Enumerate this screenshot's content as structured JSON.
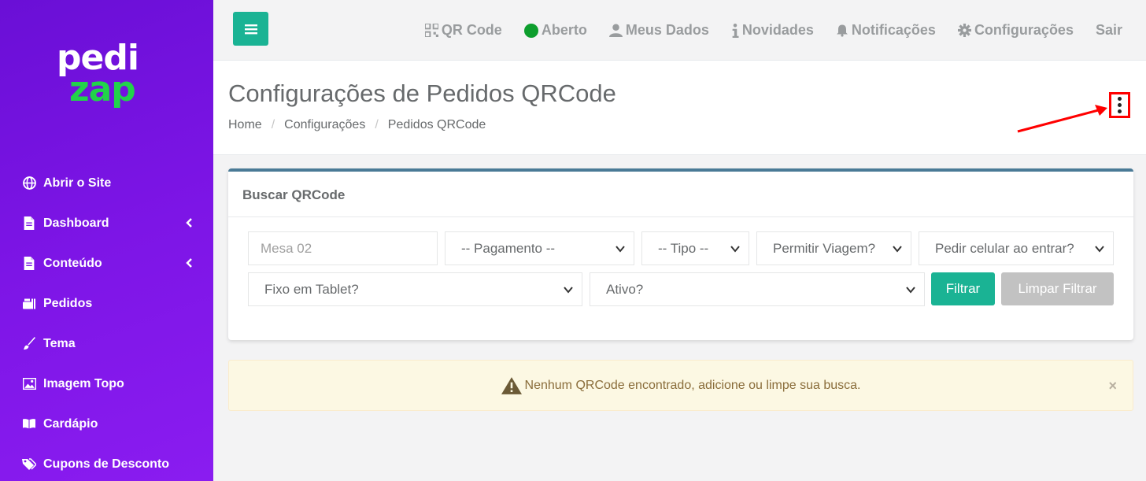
{
  "logo": {
    "line1": "pedi",
    "line2": "zap"
  },
  "sidebar": {
    "items": [
      {
        "label": "Abrir o Site",
        "icon": "globe-icon",
        "has_chevron": false
      },
      {
        "label": "Dashboard",
        "icon": "file-icon",
        "has_chevron": true
      },
      {
        "label": "Conteúdo",
        "icon": "file-icon",
        "has_chevron": true
      },
      {
        "label": "Pedidos",
        "icon": "food-icon",
        "has_chevron": false
      },
      {
        "label": "Tema",
        "icon": "brush-icon",
        "has_chevron": false
      },
      {
        "label": "Imagem Topo",
        "icon": "image-icon",
        "has_chevron": false
      },
      {
        "label": "Cardápio",
        "icon": "book-icon",
        "has_chevron": false
      },
      {
        "label": "Cupons de Desconto",
        "icon": "tags-icon",
        "has_chevron": false
      }
    ]
  },
  "topnav": {
    "qrcode": "QR Code",
    "aberto": "Aberto",
    "meus_dados": "Meus Dados",
    "novidades": "Novidades",
    "notificacoes": "Notificações",
    "configuracoes": "Configurações",
    "sair": "Sair"
  },
  "page": {
    "title": "Configurações de Pedidos QRCode",
    "breadcrumb": [
      "Home",
      "Configurações",
      "Pedidos QRCode"
    ]
  },
  "search": {
    "title": "Buscar QRCode",
    "mesa_placeholder": "Mesa 02",
    "pagamento": "-- Pagamento --",
    "tipo": "-- Tipo --",
    "viagem": "Permitir Viagem?",
    "celular": "Pedir celular ao entrar?",
    "tablet": "Fixo em Tablet?",
    "ativo": "Ativo?",
    "filtrar": "Filtrar",
    "limpar": "Limpar Filtrar"
  },
  "alert": {
    "message": "Nenhum QRCode encontrado, adicione ou limpe sua busca.",
    "close": "×"
  },
  "colors": {
    "sidebar_bg": "#7d15e6",
    "primary": "#1ab394",
    "status_open": "#0d9e2d",
    "highlight": "#ff0000",
    "box_border": "#4a7a96"
  }
}
